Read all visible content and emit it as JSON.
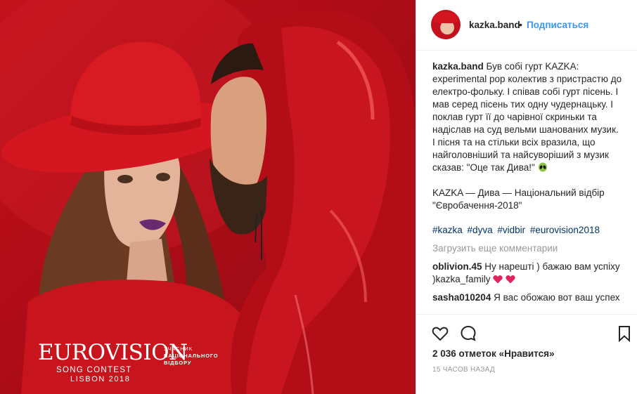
{
  "photo": {
    "logo": {
      "main": "EUROVISION",
      "contest": "SONG CONTEST",
      "city": "LISBON 2018"
    },
    "badge": [
      "УЧАСНИК",
      "НАЦІОНАЛЬНОГО",
      "ВІДБОРУ"
    ]
  },
  "post": {
    "author": "kazka.band",
    "separator": "•",
    "follow_label": "Подписаться",
    "caption_user": "kazka.band",
    "caption_text": "Був собі гурт KAZKA: experimental pop колектив з пристрастю до електро-фольку. І співав собі гурт пісень. І мав серед пісень тих одну чудернацьку. І поклав гурт її до чарівної скриньки та надіслав на суд вельми шанованих музик. І пісня та на стільки всіх вразила, що найголовніший та найсуворіший з музик сказав: \"Оце так Дива!\"",
    "caption_line2": "KAZKA — Дива — Національний відбір \"Євробачення-2018\"",
    "hashtags": [
      "#kazka",
      "#dyva",
      "#vidbir",
      "#eurovision2018"
    ],
    "load_more": "Загрузить еще комментарии",
    "comments": [
      {
        "user": "oblivion.45",
        "text": "Ну нарешті ) бажаю вам успіху )kazka_family"
      },
      {
        "user": "sasha010204",
        "text": "Я вас обожаю вот ваш успех"
      }
    ],
    "likes": "2 036 отметок «Нравится»",
    "time": "15 ЧАСОВ НАЗАД"
  },
  "icons": {
    "like": "heart-outline-icon",
    "comment": "comment-bubble-icon",
    "save": "bookmark-icon"
  }
}
